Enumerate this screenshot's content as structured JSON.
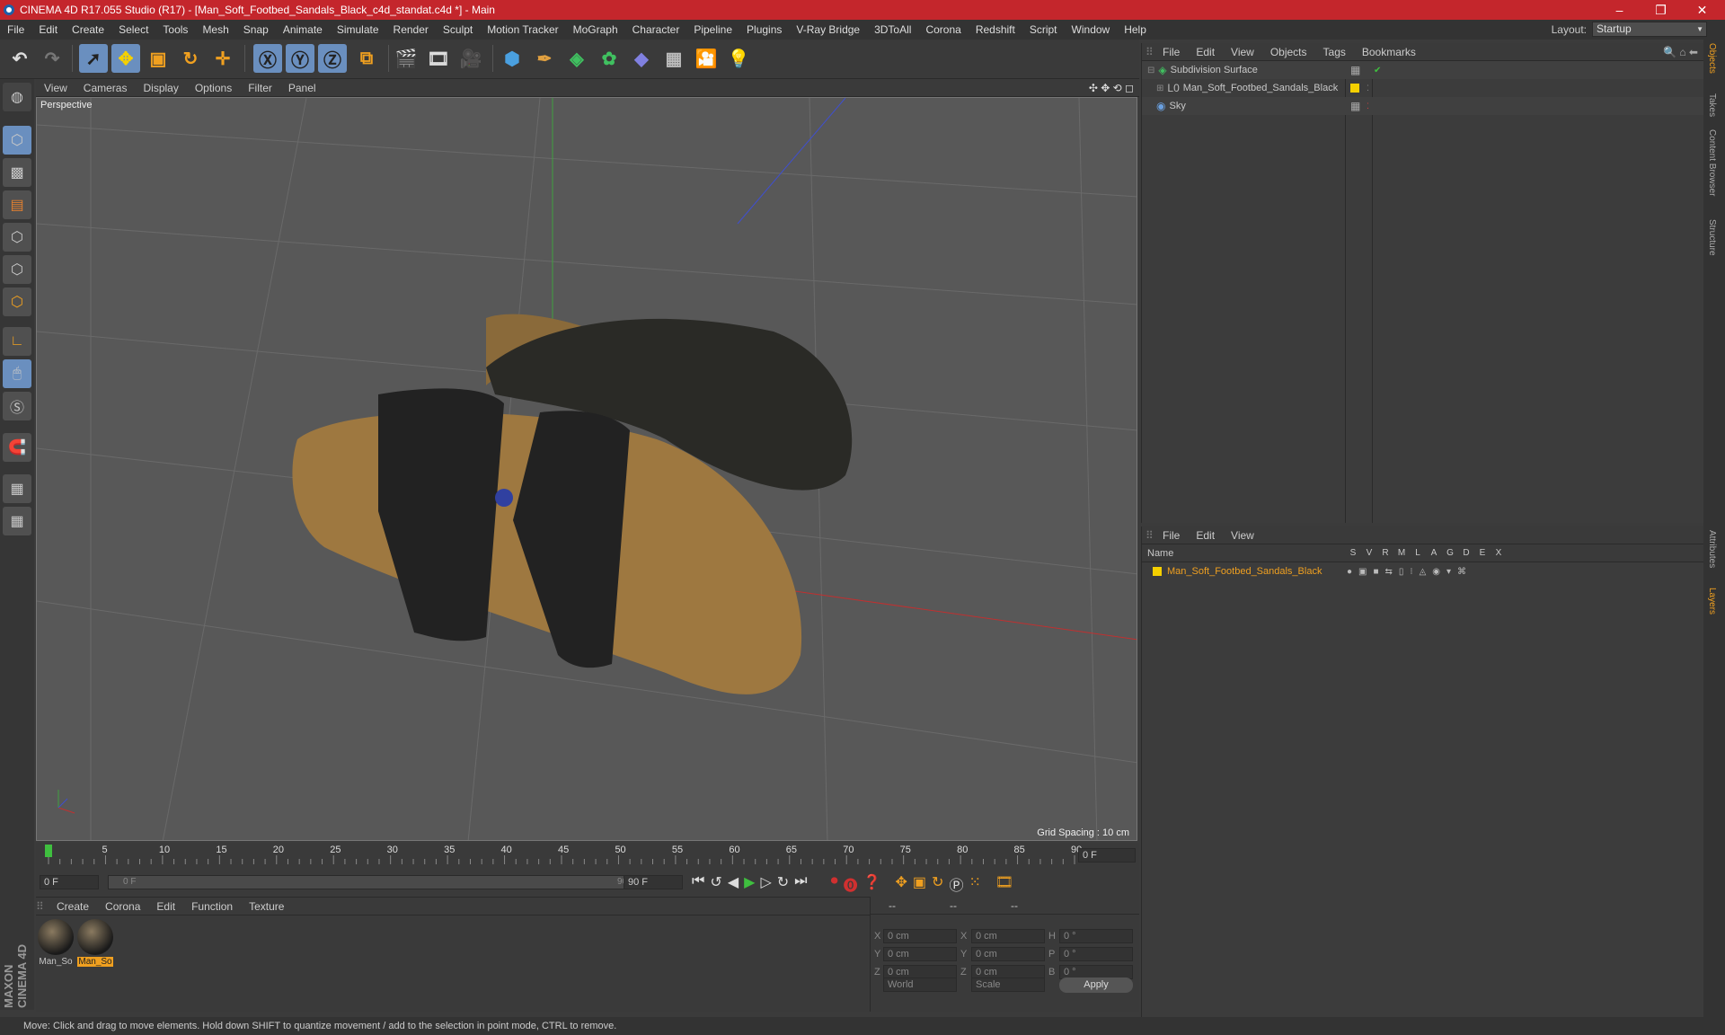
{
  "titlebar": {
    "title": "CINEMA 4D R17.055 Studio (R17) - [Man_Soft_Footbed_Sandals_Black_c4d_standat.c4d *] - Main"
  },
  "menu": [
    "File",
    "Edit",
    "Create",
    "Select",
    "Tools",
    "Mesh",
    "Snap",
    "Animate",
    "Simulate",
    "Render",
    "Sculpt",
    "Motion Tracker",
    "MoGraph",
    "Character",
    "Pipeline",
    "Plugins",
    "V-Ray Bridge",
    "3DToAll",
    "Corona",
    "Redshift",
    "Script",
    "Window",
    "Help"
  ],
  "layout": {
    "label": "Layout:",
    "value": "Startup"
  },
  "viewport": {
    "menu": [
      "View",
      "Cameras",
      "Display",
      "Options",
      "Filter",
      "Panel"
    ],
    "label": "Perspective",
    "grid_spacing": "Grid Spacing : 10 cm"
  },
  "timeline": {
    "ticks": [
      "0",
      "5",
      "10",
      "15",
      "20",
      "25",
      "30",
      "35",
      "40",
      "45",
      "50",
      "55",
      "60",
      "65",
      "70",
      "75",
      "80",
      "85",
      "90"
    ],
    "frame_field": "0 F",
    "start": "0 F",
    "slider_left": "0 F",
    "slider_right": "90 F",
    "end": "90 F"
  },
  "materials": {
    "menu": [
      "Create",
      "Corona",
      "Edit",
      "Function",
      "Texture"
    ],
    "items": [
      "Man_So",
      "Man_So"
    ]
  },
  "coords": {
    "header": [
      "--",
      "--",
      "--"
    ],
    "rows": [
      {
        "a": "X",
        "av": "0 cm",
        "b": "X",
        "bv": "0 cm",
        "c": "H",
        "cv": "0 °"
      },
      {
        "a": "Y",
        "av": "0 cm",
        "b": "Y",
        "bv": "0 cm",
        "c": "P",
        "cv": "0 °"
      },
      {
        "a": "Z",
        "av": "0 cm",
        "b": "Z",
        "bv": "0 cm",
        "c": "B",
        "cv": "0 °"
      }
    ],
    "world": "World",
    "scale": "Scale",
    "apply": "Apply"
  },
  "objects": {
    "menu": [
      "File",
      "Edit",
      "View",
      "Objects",
      "Tags",
      "Bookmarks"
    ],
    "items": [
      "Subdivision Surface",
      "Man_Soft_Footbed_Sandals_Black",
      "Sky"
    ]
  },
  "layers": {
    "menu": [
      "File",
      "Edit",
      "View"
    ],
    "col_name": "Name",
    "cols": [
      "S",
      "V",
      "R",
      "M",
      "L",
      "A",
      "G",
      "D",
      "E",
      "X"
    ],
    "item": "Man_Soft_Footbed_Sandals_Black"
  },
  "righttabs": [
    "Objects",
    "Takes",
    "Content Browser",
    "Structure",
    "Attributes",
    "Layers"
  ],
  "brand": "MAXON CINEMA 4D",
  "status": "Move: Click and drag to move elements. Hold down SHIFT to quantize movement / add to the selection in point mode, CTRL to remove.",
  "colors": {
    "title": "#c4262c",
    "accent_yellow": "#f5d000",
    "active_orange": "#f0a020"
  },
  "icons": [
    "app-icon",
    "undo-icon",
    "redo-icon",
    "select-arrow-icon",
    "move-icon",
    "scale-icon",
    "rotate-icon",
    "x-axis-icon",
    "y-axis-icon",
    "z-axis-icon",
    "render-icon",
    "cube-icon",
    "light-icon",
    "play-icon"
  ]
}
